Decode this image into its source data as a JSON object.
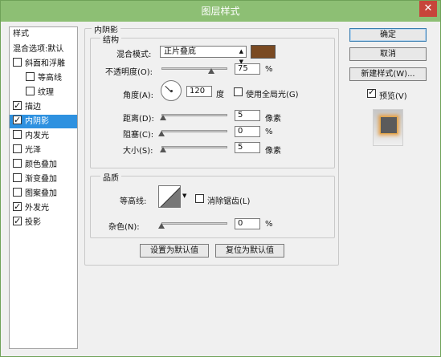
{
  "window": {
    "title": "图层样式",
    "close_label": "✕"
  },
  "styles_panel": {
    "header": "样式",
    "items": [
      {
        "label": "混合选项:默认",
        "kind": "plain"
      },
      {
        "label": "斜面和浮雕",
        "checked": false
      },
      {
        "label": "等高线",
        "checked": false,
        "sub": true
      },
      {
        "label": "纹理",
        "checked": false,
        "sub": true
      },
      {
        "label": "描边",
        "checked": true
      },
      {
        "label": "内阴影",
        "checked": true,
        "selected": true
      },
      {
        "label": "内发光",
        "checked": false
      },
      {
        "label": "光泽",
        "checked": false
      },
      {
        "label": "颜色叠加",
        "checked": false
      },
      {
        "label": "渐变叠加",
        "checked": false
      },
      {
        "label": "图案叠加",
        "checked": false
      },
      {
        "label": "外发光",
        "checked": true
      },
      {
        "label": "投影",
        "checked": true
      }
    ]
  },
  "inner_shadow": {
    "section_title": "内阴影",
    "structure_title": "结构",
    "blend_mode_label": "混合模式:",
    "blend_mode_value": "正片叠底",
    "color": "#7a4a22",
    "opacity_label": "不透明度(O):",
    "opacity_value": "75",
    "opacity_unit": "%",
    "opacity_fraction": 0.75,
    "angle_label": "角度(A):",
    "angle_value": "120",
    "angle_unit": "度",
    "global_light_label": "使用全局光(G)",
    "global_light_checked": false,
    "distance_label": "距离(D):",
    "distance_value": "5",
    "distance_unit": "像素",
    "distance_fraction": 0.02,
    "choke_label": "阻塞(C):",
    "choke_value": "0",
    "choke_unit": "%",
    "choke_fraction": 0,
    "size_label": "大小(S):",
    "size_value": "5",
    "size_unit": "像素",
    "size_fraction": 0.02,
    "quality_title": "品质",
    "contour_label": "等高线:",
    "anti_alias_label": "消除锯齿(L)",
    "anti_alias_checked": false,
    "noise_label": "杂色(N):",
    "noise_value": "0",
    "noise_unit": "%",
    "noise_fraction": 0,
    "set_default_label": "设置为默认值",
    "reset_default_label": "复位为默认值"
  },
  "actions": {
    "ok_label": "确定",
    "cancel_label": "取消",
    "new_style_label": "新建样式(W)...",
    "preview_label": "预览(V)",
    "preview_checked": true
  }
}
